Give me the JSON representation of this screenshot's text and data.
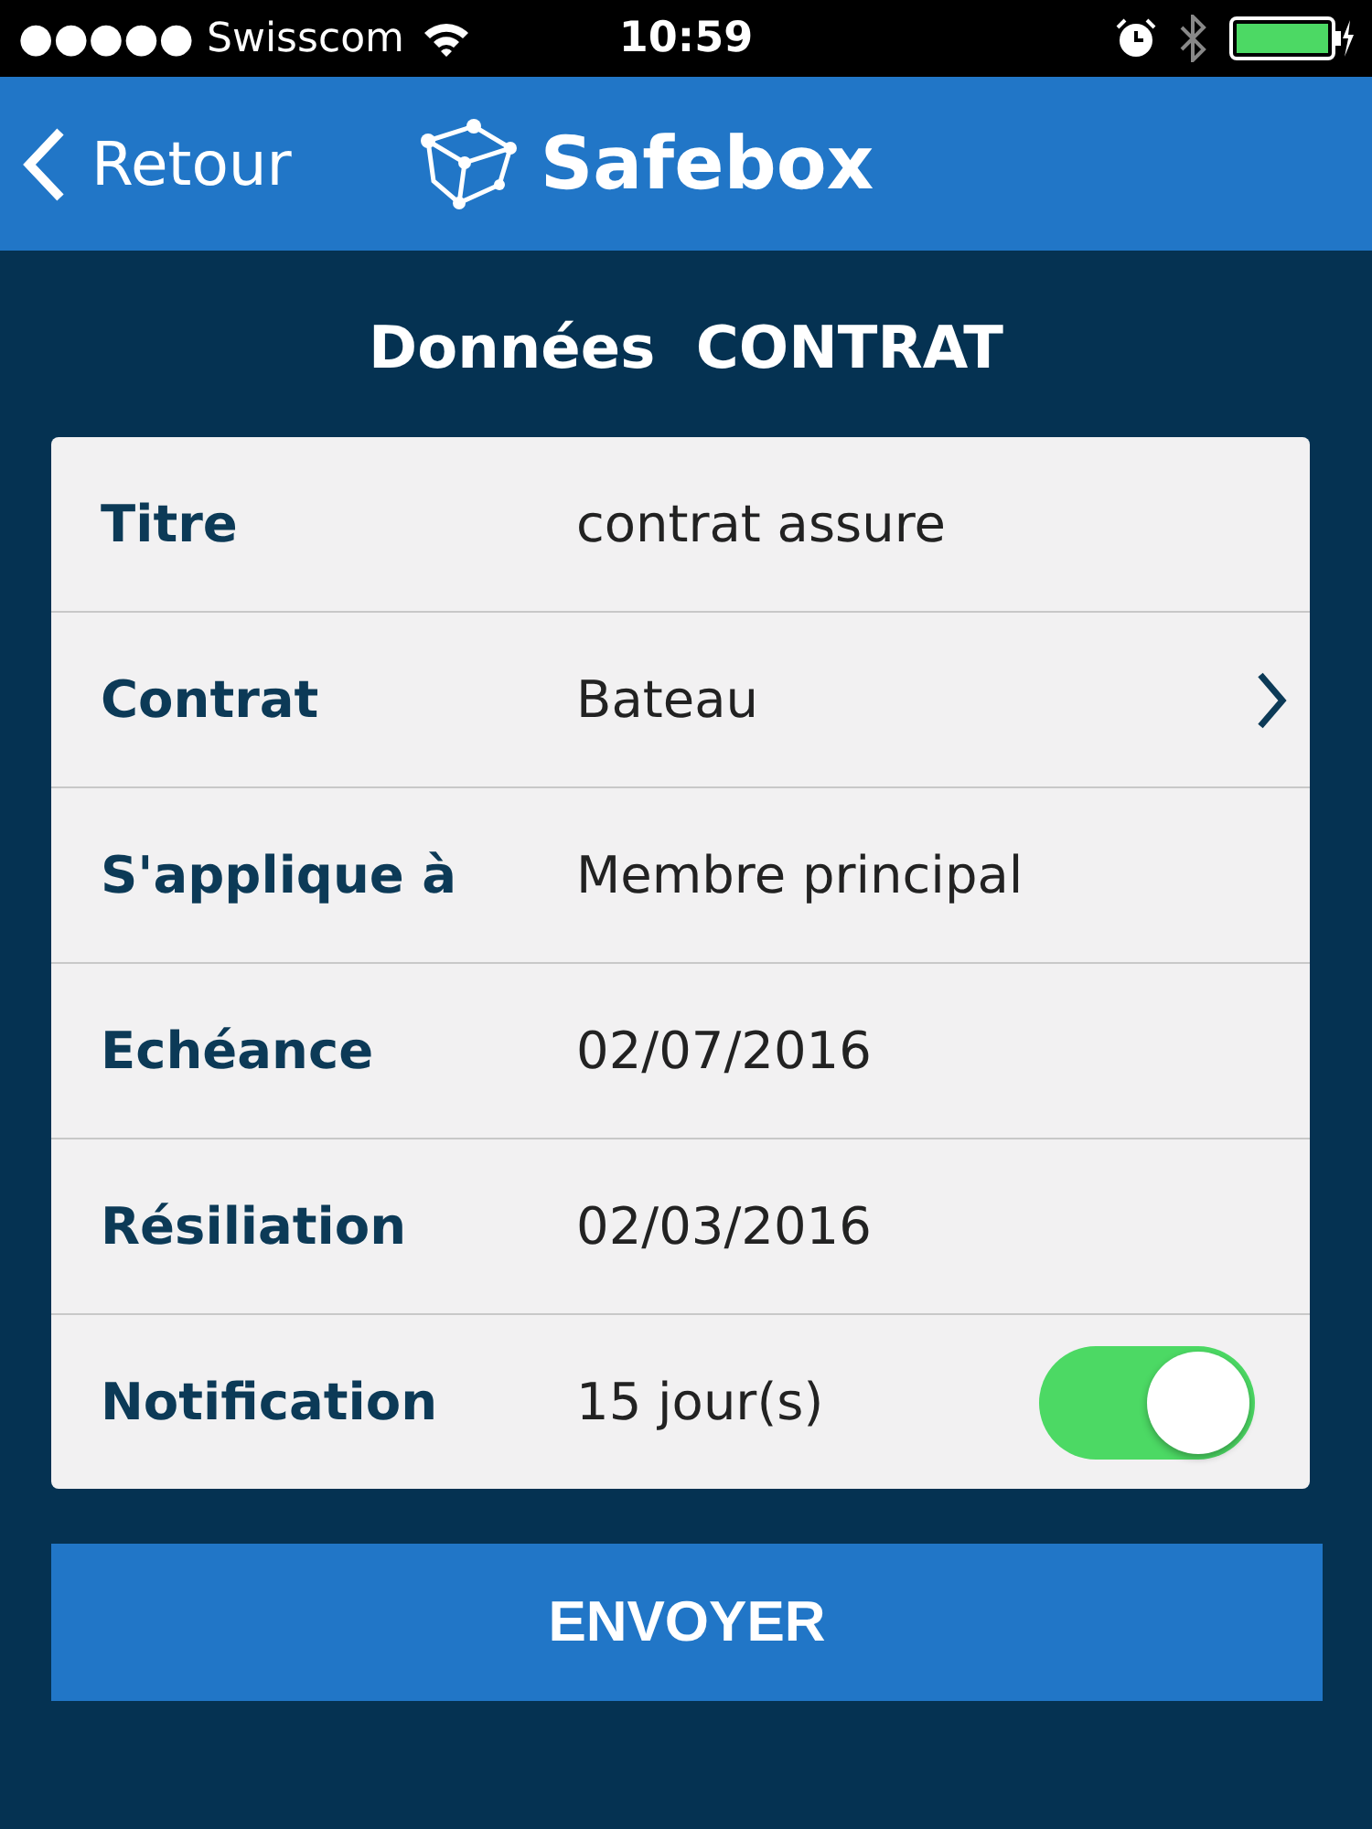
{
  "status_bar": {
    "signal_dots": "●●●●●",
    "carrier": "Swisscom",
    "time": "10:59"
  },
  "nav": {
    "back": "Retour",
    "brand": "Safebox"
  },
  "title": "Données  CONTRAT",
  "rows": [
    {
      "kind": "text",
      "label": "Titre",
      "value": "contrat assure"
    },
    {
      "kind": "link",
      "label": "Contrat",
      "value": "Bateau"
    },
    {
      "kind": "text",
      "label": "S'applique à",
      "value": "Membre principal"
    },
    {
      "kind": "text",
      "label": "Echéance",
      "value": "02/07/2016"
    },
    {
      "kind": "text",
      "label": "Résiliation",
      "value": "02/03/2016"
    },
    {
      "kind": "toggle",
      "label": "Notification",
      "value": "15 jour(s)",
      "on": true
    }
  ],
  "submit": "ENVOYER"
}
